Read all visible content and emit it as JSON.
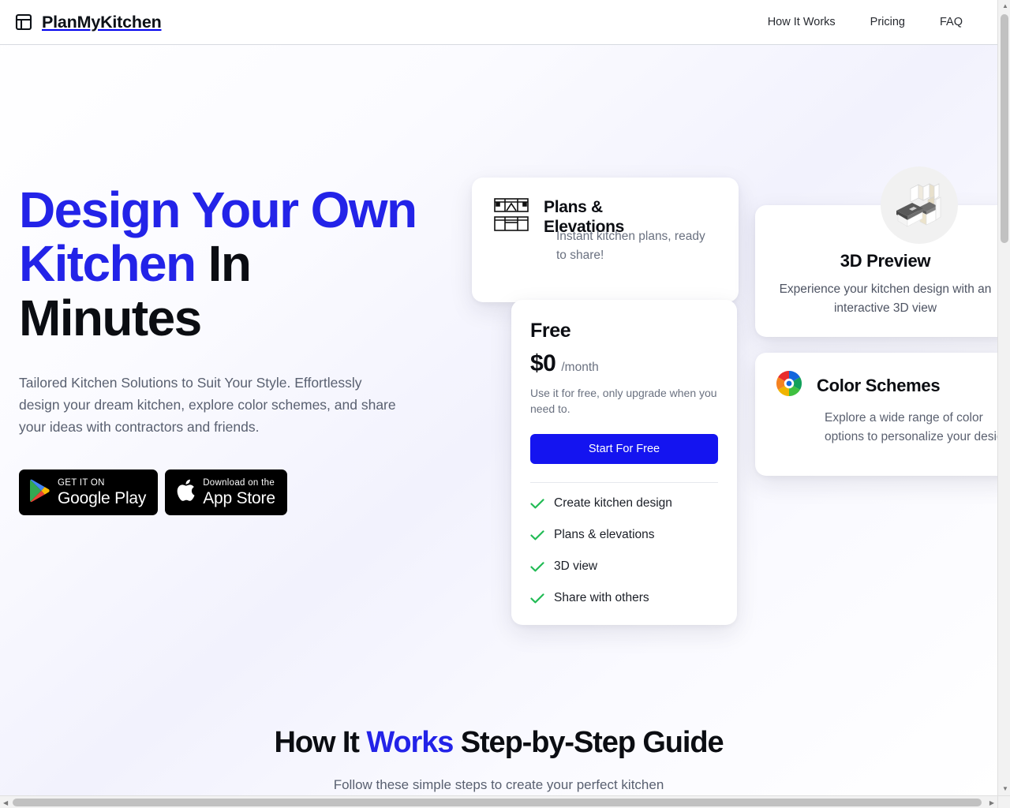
{
  "header": {
    "brand": "PlanMyKitchen",
    "brand_icon": "layout-panel-icon",
    "nav": [
      {
        "label": "How It Works"
      },
      {
        "label": "Pricing"
      },
      {
        "label": "FAQ"
      }
    ]
  },
  "hero": {
    "title_line1_accent": "Design Your Own",
    "title_line2_accent": "Kitchen",
    "title_line2_plain": " In",
    "title_line3_plain": "Minutes",
    "subtitle": "Tailored Kitchen Solutions to Suit Your Style. Effortlessly design your dream kitchen, explore color schemes, and share your ideas with contractors and friends.",
    "store_badges": [
      {
        "icon": "google-play-icon",
        "small": "GET IT ON",
        "big": "Google Play"
      },
      {
        "icon": "apple-logo-icon",
        "small": "Download on the",
        "big": "App Store"
      }
    ]
  },
  "cards": {
    "plans": {
      "icon": "floor-plan-icon",
      "title": "Plans & Elevations",
      "description": "Instant kitchen plans, ready to share!"
    },
    "pricing": {
      "plan_name": "Free",
      "amount": "$0",
      "period": "/month",
      "note": "Use it for free, only upgrade when you need to.",
      "cta_label": "Start For Free",
      "features": [
        {
          "label": "Create kitchen design",
          "icon": "check-icon"
        },
        {
          "label": "Plans & elevations",
          "icon": "check-icon"
        },
        {
          "label": "3D view",
          "icon": "check-icon"
        },
        {
          "label": "Share with others",
          "icon": "check-icon"
        }
      ]
    },
    "preview3d": {
      "icon": "isometric-kitchen-icon",
      "title": "3D Preview",
      "description": "Experience your kitchen design with an interactive 3D view"
    },
    "color": {
      "icon": "color-wheel-icon",
      "title": "Color Schemes",
      "description": "Explore a wide range of color options to personalize your design."
    }
  },
  "how_it_works": {
    "title_part1": "How It ",
    "title_accent": "Works",
    "title_part2": " Step-by-Step Guide",
    "subtitle": "Follow these simple steps to create your perfect kitchen"
  },
  "colors": {
    "accent_blue": "#2323e8",
    "cta_blue": "#1414f0",
    "check_green": "#22bb55",
    "text_dark": "#0b0d12",
    "text_muted": "#6a7180"
  }
}
